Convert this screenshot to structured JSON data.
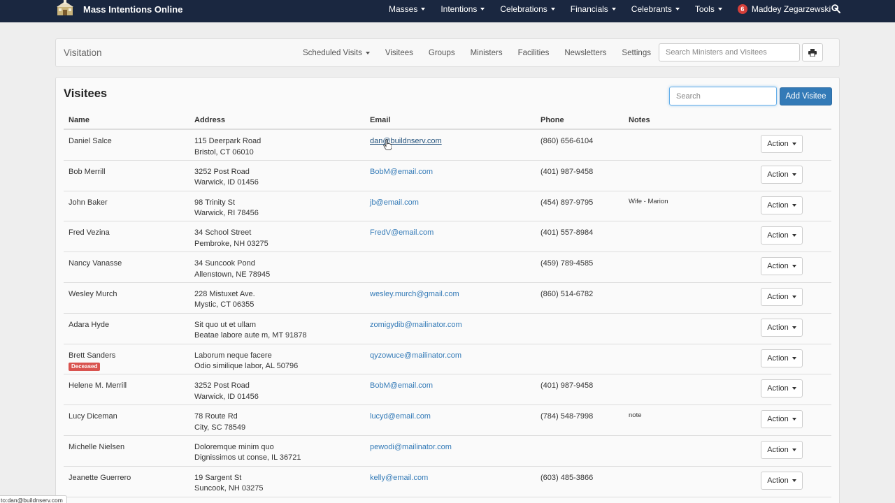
{
  "app": {
    "title": "Mass Intentions Online"
  },
  "nav": {
    "items": [
      "Masses",
      "Intentions",
      "Celebrations",
      "Financials",
      "Celebrants",
      "Tools"
    ],
    "notification_count": "6",
    "user": "Maddey Zegarzewski"
  },
  "subnav": {
    "title": "Visitation",
    "links": [
      {
        "label": "Scheduled Visits",
        "dropdown": true
      },
      {
        "label": "Visitees",
        "dropdown": false
      },
      {
        "label": "Groups",
        "dropdown": false
      },
      {
        "label": "Ministers",
        "dropdown": false
      },
      {
        "label": "Facilities",
        "dropdown": false
      },
      {
        "label": "Newsletters",
        "dropdown": false
      },
      {
        "label": "Settings",
        "dropdown": false
      }
    ],
    "search_placeholder": "Search Ministers and Visitees"
  },
  "panel": {
    "title": "Visitees",
    "search_placeholder": "Search",
    "add_label": "Add Visitee",
    "columns": {
      "name": "Name",
      "address": "Address",
      "email": "Email",
      "phone": "Phone",
      "notes": "Notes"
    },
    "action_label": "Action",
    "rows": [
      {
        "name": "Daniel Salce",
        "badge": "",
        "addr1": "115 Deerpark Road",
        "addr2": "Bristol, CT 06010",
        "email": "dan@buildnserv.com",
        "phone": "(860) 656-6104",
        "notes": ""
      },
      {
        "name": "Bob Merrill",
        "badge": "",
        "addr1": "3252 Post Road",
        "addr2": "Warwick, ID 01456",
        "email": "BobM@email.com",
        "phone": "(401) 987-9458",
        "notes": ""
      },
      {
        "name": "John Baker",
        "badge": "",
        "addr1": "98 Trinity St",
        "addr2": "Warwick, RI 78456",
        "email": "jb@email.com",
        "phone": "(454) 897-9795",
        "notes": "Wife - Marion"
      },
      {
        "name": "Fred Vezina",
        "badge": "",
        "addr1": "34 School Street",
        "addr2": "Pembroke, NH 03275",
        "email": "FredV@email.com",
        "phone": "(401) 557-8984",
        "notes": ""
      },
      {
        "name": "Nancy Vanasse",
        "badge": "",
        "addr1": "34 Suncook Pond",
        "addr2": "Allenstown, NE 78945",
        "email": "",
        "phone": "(459) 789-4585",
        "notes": ""
      },
      {
        "name": "Wesley Murch",
        "badge": "",
        "addr1": "228 Mistuxet Ave.",
        "addr2": "Mystic, CT 06355",
        "email": "wesley.murch@gmail.com",
        "phone": "(860) 514-6782",
        "notes": ""
      },
      {
        "name": "Adara Hyde",
        "badge": "",
        "addr1": "Sit quo ut et ullam",
        "addr2": "Beatae labore aute m, MT 91878",
        "email": "zomigydib@mailinator.com",
        "phone": "",
        "notes": ""
      },
      {
        "name": "Brett Sanders",
        "badge": "Deceased",
        "addr1": "Laborum neque facere",
        "addr2": "Odio similique labor, AL 50796",
        "email": "qyzowuce@mailinator.com",
        "phone": "",
        "notes": ""
      },
      {
        "name": "Helene M. Merrill",
        "badge": "",
        "addr1": "3252 Post Road",
        "addr2": "Warwick, ID 01456",
        "email": "BobM@email.com",
        "phone": "(401) 987-9458",
        "notes": ""
      },
      {
        "name": "Lucy Diceman",
        "badge": "",
        "addr1": "78 Route Rd",
        "addr2": "City, SC 78549",
        "email": "lucyd@email.com",
        "phone": "(784) 548-7998",
        "notes": "note"
      },
      {
        "name": "Michelle Nielsen",
        "badge": "",
        "addr1": "Doloremque minim quo",
        "addr2": "Dignissimos ut conse, IL 36721",
        "email": "pewodi@mailinator.com",
        "phone": "",
        "notes": ""
      },
      {
        "name": "Jeanette Guerrero",
        "badge": "",
        "addr1": "19 Sargent St",
        "addr2": "Suncook, NH 03275",
        "email": "kelly@email.com",
        "phone": "(603) 485-3866",
        "notes": ""
      }
    ]
  },
  "statusbar": {
    "text": "to:dan@buildnserv.com"
  },
  "colors": {
    "navbar": "#1a2740",
    "link": "#337ab7",
    "primary": "#337ab7",
    "badge": "#d9534f"
  }
}
